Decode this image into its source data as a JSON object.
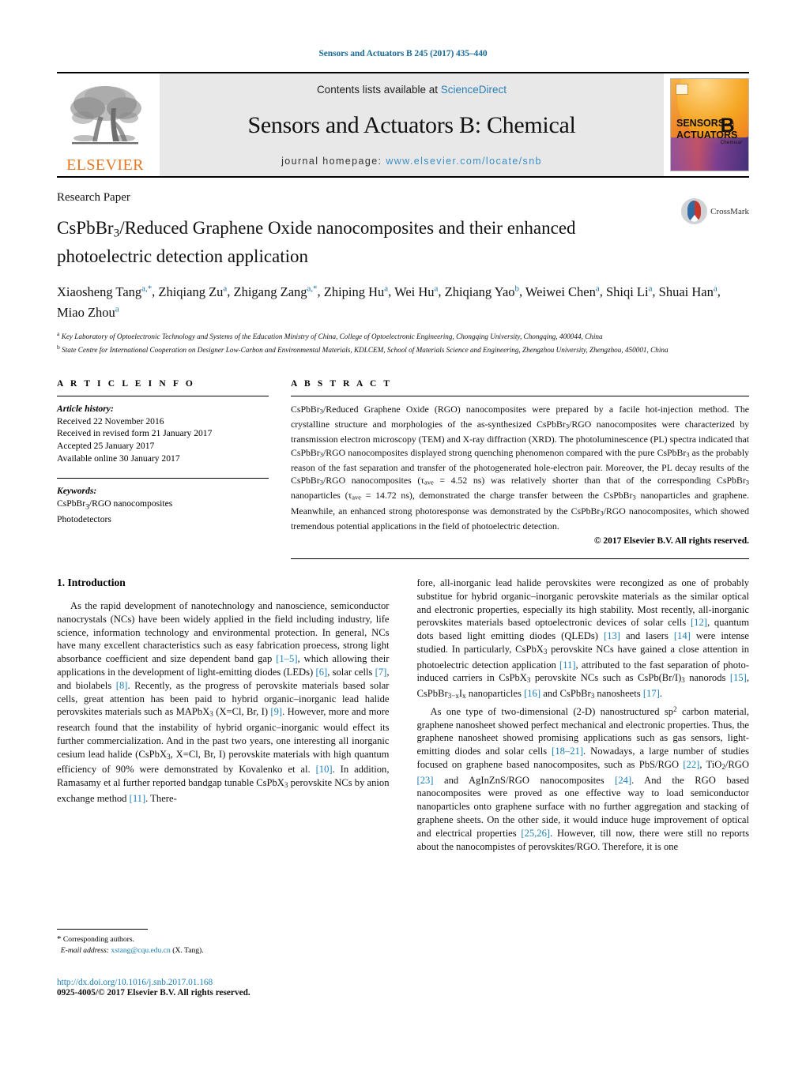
{
  "running_head": "Sensors and Actuators B 245 (2017) 435–440",
  "masthead": {
    "publisher_logo_text": "ELSEVIER",
    "contents_prefix": "Contents lists available at ",
    "contents_link": "ScienceDirect",
    "journal_title": "Sensors and Actuators B: Chemical",
    "homepage_prefix": "journal homepage: ",
    "homepage_url": "www.elsevier.com/locate/snb",
    "cover": {
      "line1": "SENSORS",
      "line1_small": "and",
      "line2": "ACTUATORS",
      "letter": "B",
      "letter_sub": "Chemical"
    }
  },
  "article": {
    "kicker": "Research Paper",
    "title_line1_a": "CsPbBr",
    "title_line1_sub": "3",
    "title_line1_b": "/Reduced Graphene Oxide nanocomposites and their",
    "title_line2": "enhanced photoelectric detection application",
    "crossmark_label": "CrossMark",
    "authors_line1": "Xiaosheng Tang",
    "authors": [
      {
        "name": "Xiaosheng Tang",
        "marks": "a,*"
      },
      {
        "name": "Zhiqiang Zu",
        "marks": "a"
      },
      {
        "name": "Zhigang Zang",
        "marks": "a,*"
      },
      {
        "name": "Zhiping Hu",
        "marks": "a"
      },
      {
        "name": "Wei Hu",
        "marks": "a"
      },
      {
        "name": "Zhiqiang Yao",
        "marks": "b"
      },
      {
        "name": "Weiwei Chen",
        "marks": "a"
      },
      {
        "name": "Shiqi Li",
        "marks": "a"
      },
      {
        "name": "Shuai Han",
        "marks": "a"
      },
      {
        "name": "Miao Zhou",
        "marks": "a"
      }
    ],
    "affiliations": [
      {
        "mark": "a",
        "text": "Key Laboratory of Optoelectronic Technology and Systems of the Education Ministry of China, College of Optoelectronic Engineering, Chongqing University, Chongqing, 400044, China"
      },
      {
        "mark": "b",
        "text": "State Centre for International Cooperation on Designer Low-Carbon and Environmental Materials, KDLCEM, School of Materials Science and Engineering, Zhengzhou University, Zhengzhou, 450001, China"
      }
    ]
  },
  "article_info": {
    "heading": "A R T I C L E   I N F O",
    "history_label": "Article history:",
    "history": [
      "Received 22 November 2016",
      "Received in revised form 21 January 2017",
      "Accepted 25 January 2017",
      "Available online 30 January 2017"
    ],
    "keywords_label": "Keywords:",
    "keywords": [
      "CsPbBr3/RGO nanocomposites",
      "Photodetectors"
    ]
  },
  "abstract": {
    "heading": "A B S T R A C T",
    "body": "CsPbBr3/Reduced Graphene Oxide (RGO) nanocomposites were prepared by a facile hot-injection method. The crystalline structure and morphologies of the as-synthesized CsPbBr3/RGO nanocomposites were characterized by transmission electron microscopy (TEM) and X-ray diffraction (XRD). The photoluminescence (PL) spectra indicated that CsPbBr3/RGO nanocomposites displayed strong quenching phenomenon compared with the pure CsPbBr3 as the probably reason of the fast separation and transfer of the photogenerated hole-electron pair. Moreover, the PL decay results of the CsPbBr3/RGO nanocomposites (τave = 4.52 ns) was relatively shorter than that of the corresponding CsPbBr3 nanoparticles (τave = 14.72 ns), demonstrated the charge transfer between the CsPbBr3 nanoparticles and graphene. Meanwhile, an enhanced strong photoresponse was demonstrated by the CsPbBr3/RGO nanocomposites, which showed tremendous potential applications in the field of photoelectric detection.",
    "copyright": "© 2017 Elsevier B.V. All rights reserved."
  },
  "introduction": {
    "heading": "1.  Introduction",
    "left_paragraph": "As the rapid development of nanotechnology and nanoscience, semiconductor nanocrystals (NCs) have been widely applied in the field including industry, life science, information technology and environmental protection. In general, NCs have many excellent characteristics such as easy fabrication proecess, strong light absorbance coefficient and size dependent band gap [1–5], which allowing their applications in the development of light-emitting diodes (LEDs) [6], solar cells [7], and biolabels [8]. Recently, as the progress of perovskite materials based solar cells, great attention has been paid to hybrid organic–inorganic lead halide perovskites materials such as MAPbX3 (X = Cl, Br, I) [9]. However, more and more research found that the instability of hybrid organic–inorganic would effect its further commercialization. And in the past two years, one interesting all inorganic cesium lead halide (CsPbX3, X = Cl, Br, I) perovskite materials with high quantum efficiency of 90% were demonstrated by Kovalenko et al. [10]. In addition, Ramasamy et al further reported bandgap tunable CsPbX3 perovskite NCs by anion exchange method [11]. There-",
    "right_paragraph_1": "fore, all-inorganic lead halide perovskites were recongized as one of probably substitue for hybrid organic–inorganic perovskite materials as the similar optical and electronic properties, especially its high stability. Most recently, all-inorganic perovskites materials based optoelectronic devices of solar cells [12], quantum dots based light emitting diodes (QLEDs) [13] and lasers [14] were intense studied. In particularly, CsPbX3 perovskite NCs have gained a close attention in photoelectric detection application [11], attributed to the fast separation of photo-induced carriers in CsPbX3 perovskite NCs such as CsPb(Br/I)3 nanorods [15], CsPbBr3−xIx nanoparticles [16] and CsPbBr3 nanosheets [17].",
    "right_paragraph_2": "As one type of two-dimensional (2-D) nanostructured sp2 carbon material, graphene nanosheet showed perfect mechanical and electronic properties. Thus, the graphene nanosheet showed promising applications such as gas sensors, light-emitting diodes and solar cells [18–21]. Nowadays, a large number of studies focused on graphene based nanocomposites, such as PbS/RGO [22], TiO2/RGO [23] and AgInZnS/RGO nanocomposites [24]. And the RGO based nanocomposites were proved as one effective way to load semiconductor nanoparticles onto graphene surface with no further aggregation and stacking of graphene sheets. On the other side, it would induce huge improvement of optical and electrical properties [25,26]. However, till now, there were still no reports about the nanocompistes of perovskites/RGO. Therefore, it is one"
  },
  "footnote": {
    "star": "*",
    "corresponding": "Corresponding authors.",
    "email_label": "E-mail address:",
    "email": "xstang@cqu.edu.cn",
    "email_suffix": "(X. Tang)."
  },
  "footer": {
    "doi": "http://dx.doi.org/10.1016/j.snb.2017.01.168",
    "issn_line": "0925-4005/© 2017 Elsevier B.V. All rights reserved."
  },
  "colors": {
    "link": "#1a7fb5",
    "running_head": "#1a6b9a",
    "elsevier_orange": "#E87722"
  }
}
